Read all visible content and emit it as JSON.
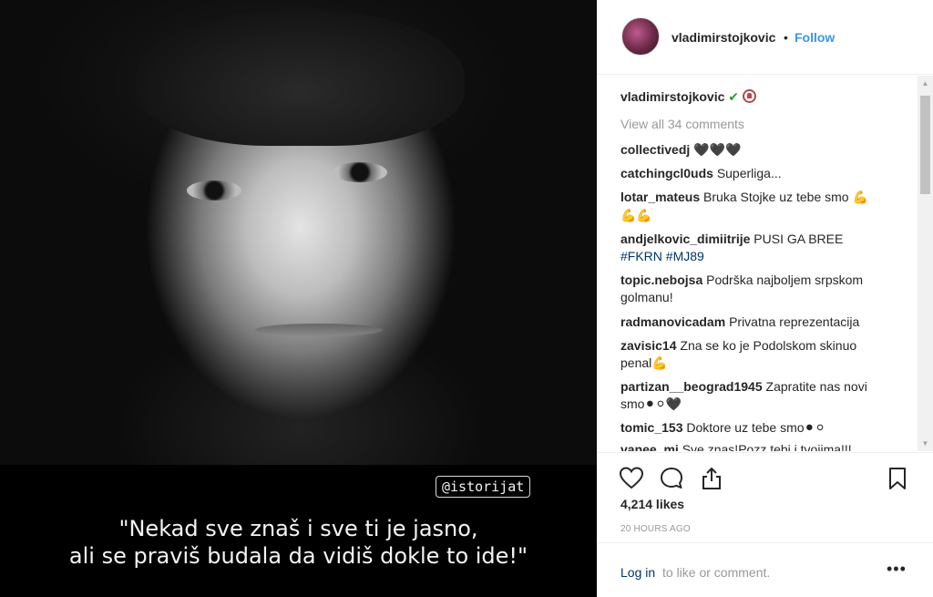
{
  "post": {
    "watermark": "@istorijat",
    "quote_line1": "\"Nekad sve znaš i sve ti je jasno,",
    "quote_line2": "ali se praviš budala da vidiš dokle to ide!\""
  },
  "header": {
    "username": "vladimirstojkovic",
    "dot": "•",
    "follow_label": "Follow"
  },
  "caption": {
    "username": "vladimirstojkovic",
    "check": "✔"
  },
  "view_all": "View all 34 comments",
  "comments": [
    {
      "user": "collectivedj",
      "text": "🖤🖤🖤"
    },
    {
      "user": "catchingcl0uds",
      "text": "Superliga..."
    },
    {
      "user": "lotar_mateus",
      "text": "Bruka Stojke uz tebe smo 💪"
    },
    {
      "user": "",
      "text": "💪💪"
    },
    {
      "user": "andjelkovic_dimiitrije",
      "text": "PUSI GA BREE"
    },
    {
      "user": "",
      "text": "#FKRN #MJ89"
    },
    {
      "user": "topic.nebojsa",
      "text": "Podrška najboljem srpskom"
    },
    {
      "user": "",
      "text": "golmanu!"
    },
    {
      "user": "radmanovicadam",
      "text": "Privatna reprezentacija"
    },
    {
      "user": "zavisic14",
      "text": "Zna se ko je Podolskom skinuo"
    },
    {
      "user": "",
      "text": "penal💪"
    },
    {
      "user": "partizan__beograd1945",
      "text": "Zapratite nas novi"
    },
    {
      "user": "",
      "text": "smo⚫⚪🖤"
    },
    {
      "user": "tomic_153",
      "text": "Doktore uz tebe smo⚫⚪"
    },
    {
      "user": "vanee_mi",
      "text": "Sve znas!Pozz tebi i tvojima!!!"
    }
  ],
  "actions": {
    "icons": [
      "heart-icon",
      "comment-icon",
      "share-icon",
      "bookmark-icon"
    ],
    "likes": "4,214 likes",
    "time": "20 HOURS AGO"
  },
  "login": {
    "link": "Log in",
    "rest": "to like or comment.",
    "more": "•••"
  },
  "colors": {
    "link_blue": "#3897f0",
    "hashtag": "#003569",
    "muted": "#999999"
  }
}
